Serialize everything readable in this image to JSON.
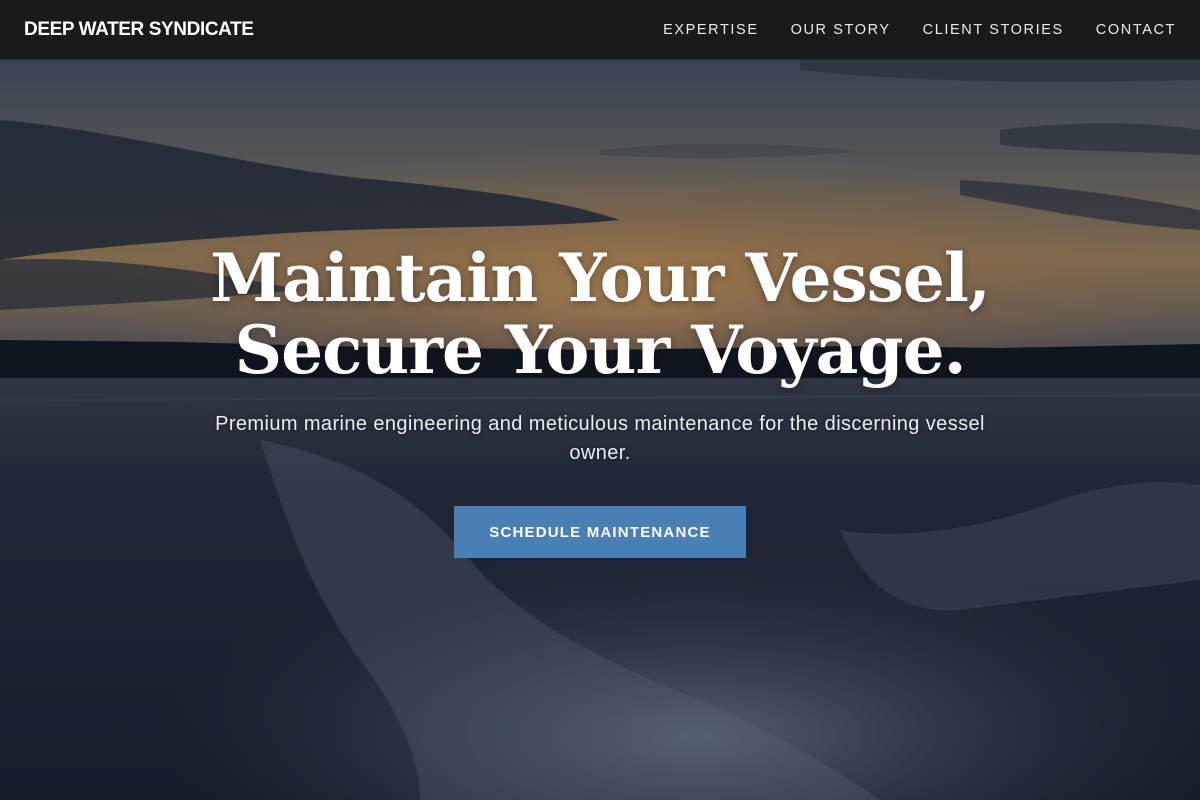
{
  "header": {
    "brand": "DEEP WATER SYNDICATE",
    "nav": [
      {
        "label": "EXPERTISE"
      },
      {
        "label": "OUR STORY"
      },
      {
        "label": "CLIENT STORIES"
      },
      {
        "label": "CONTACT"
      }
    ]
  },
  "hero": {
    "headline_line1": "Maintain Your Vessel,",
    "headline_line2": "Secure Your Voyage.",
    "subtitle": "Premium marine engineering and meticulous maintenance for the discerning vessel owner.",
    "cta_label": "SCHEDULE MAINTENANCE"
  },
  "colors": {
    "header_bg": "#1a1a1a",
    "cta_bg": "#4a7fb5",
    "text": "#ffffff"
  }
}
